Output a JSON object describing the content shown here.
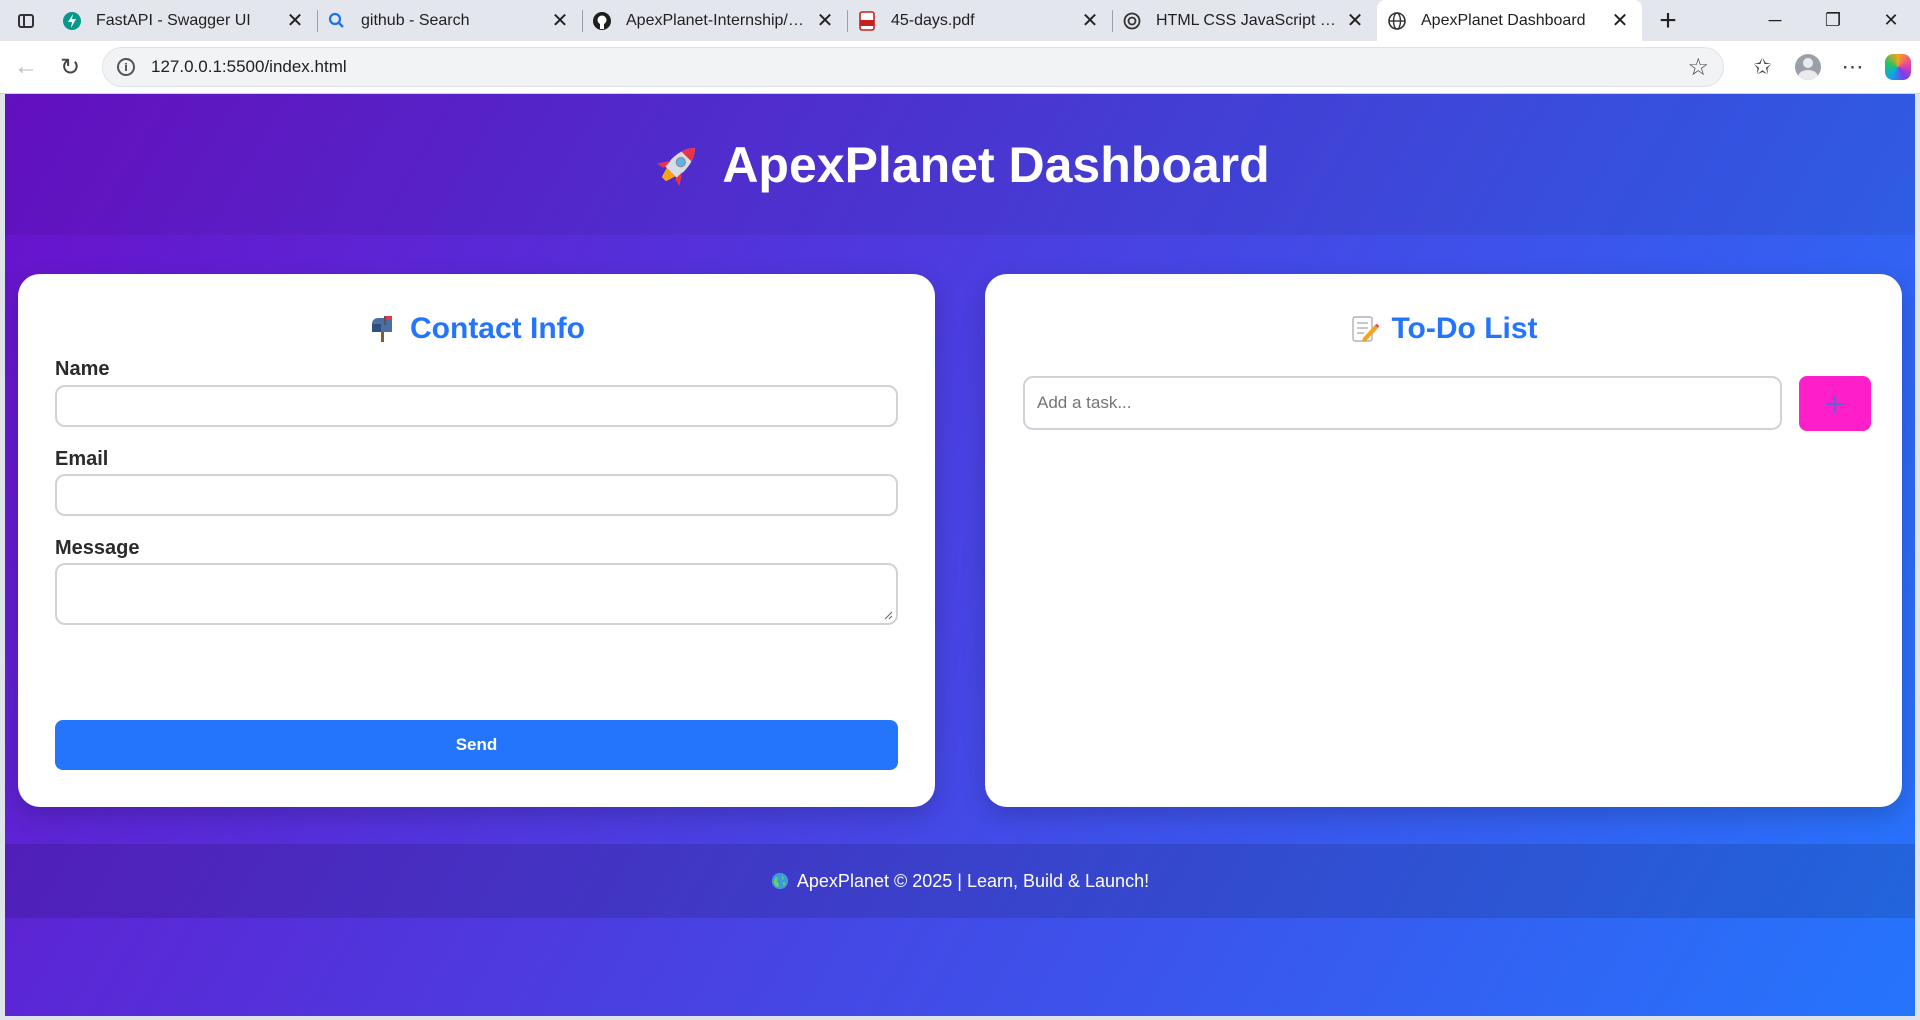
{
  "browser": {
    "tabs": [
      {
        "title": "FastAPI - Swagger UI",
        "icon": "fastapi-icon",
        "active": false
      },
      {
        "title": "github - Search",
        "icon": "search-icon",
        "active": false
      },
      {
        "title": "ApexPlanet-Internship/Task-",
        "icon": "github-icon",
        "active": false
      },
      {
        "title": "45-days.pdf",
        "icon": "pdf-icon",
        "active": false
      },
      {
        "title": "HTML CSS JavaScript project",
        "icon": "chatgpt-icon",
        "active": false
      },
      {
        "title": "ApexPlanet Dashboard",
        "icon": "globe-icon",
        "active": true
      }
    ],
    "url": "127.0.0.1:5500/index.html",
    "colors": {
      "tabbar": "#e3e6ec",
      "toolbar": "#ffffff"
    }
  },
  "page": {
    "title": "ApexPlanet Dashboard",
    "title_icon": "rocket-icon",
    "colors": {
      "gradient_start": "#6a11cb",
      "gradient_end": "#2575fc",
      "accent": "#2575fc",
      "add_button": "#ff1fca"
    },
    "contact": {
      "heading": "Contact Info",
      "heading_icon": "mailbox-icon",
      "name_label": "Name",
      "name_value": "",
      "email_label": "Email",
      "email_value": "",
      "message_label": "Message",
      "message_value": "",
      "send_label": "Send"
    },
    "todo": {
      "heading": "To-Do List",
      "heading_icon": "memo-icon",
      "input_placeholder": "Add a task...",
      "add_icon": "plus-icon",
      "tasks": []
    },
    "footer": {
      "icon": "globe-icon",
      "text": "ApexPlanet © 2025 | Learn, Build & Launch!"
    }
  }
}
